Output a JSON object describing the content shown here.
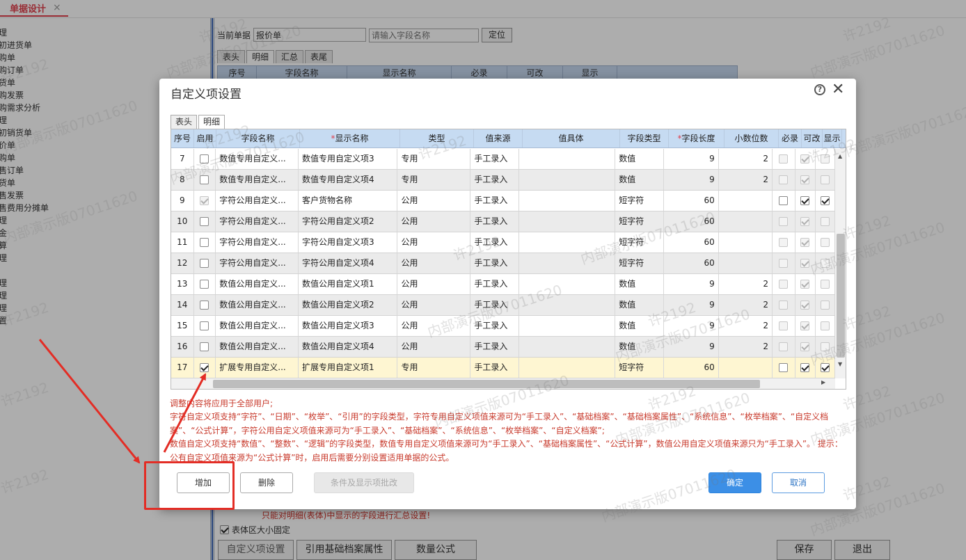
{
  "app": {
    "tab_title": "单据设计",
    "tab_close": "×",
    "nav_items": [
      "理",
      "初进货单",
      "购单",
      "购订单",
      "货单",
      "购发票",
      "购需求分析",
      "理",
      "初销货单",
      "价单",
      "购单",
      "售订单",
      "货单",
      "售发票",
      "售费用分摊单",
      "理",
      "金",
      "算",
      "理",
      "理",
      "理",
      "理",
      "置"
    ],
    "current_doc_label": "当前单据",
    "current_doc_value": "报价单",
    "field_search_placeholder": "请输入字段名称",
    "locate_button": "定位",
    "tabs": [
      "表头",
      "明细",
      "汇总",
      "表尾"
    ],
    "table_headers": [
      "序号",
      "字段名称",
      "显示名称",
      "必录",
      "可改",
      "显示"
    ],
    "summary_warning": "只能对明细(表体)中显示的字段进行汇总设置!",
    "fixed_size_label": "表体区大小固定",
    "bottom_buttons": [
      "自定义项设置",
      "引用基础档案属性",
      "数量公式"
    ],
    "save_button": "保存",
    "exit_button": "退出"
  },
  "watermark": {
    "user": "许2192",
    "version": "内部演示版07011620"
  },
  "dialog": {
    "title": "自定义项设置",
    "help_icon": "question-circle-icon",
    "close_icon": "close-icon",
    "tabs": [
      "表头",
      "明细"
    ],
    "active_tab": "明细",
    "columns": [
      {
        "label": "序号",
        "required": false
      },
      {
        "label": "启用",
        "required": false
      },
      {
        "label": "字段名称",
        "required": false
      },
      {
        "label": "显示名称",
        "required": true
      },
      {
        "label": "类型",
        "required": false
      },
      {
        "label": "值来源",
        "required": false
      },
      {
        "label": "值具体",
        "required": false
      },
      {
        "label": "字段类型",
        "required": false
      },
      {
        "label": "字段长度",
        "required": true
      },
      {
        "label": "小数位数",
        "required": false
      },
      {
        "label": "必录",
        "required": false
      },
      {
        "label": "可改",
        "required": false
      },
      {
        "label": "显示",
        "required": false
      }
    ],
    "rows": [
      {
        "no": "7",
        "enabled": false,
        "field": "数值专用自定义...",
        "display": "数值专用自定义项3",
        "type": "专用",
        "source": "手工录入",
        "detail": "",
        "ftype": "数值",
        "length": "9",
        "decimals": "2",
        "required": false,
        "editable": true,
        "visible": false,
        "active": false
      },
      {
        "no": "8",
        "enabled": false,
        "field": "数值专用自定义...",
        "display": "数值专用自定义项4",
        "type": "专用",
        "source": "手工录入",
        "detail": "",
        "ftype": "数值",
        "length": "9",
        "decimals": "2",
        "required": false,
        "editable": true,
        "visible": false,
        "active": false
      },
      {
        "no": "9",
        "enabled": true,
        "field": "字符公用自定义...",
        "display": "客户货物名称",
        "type": "公用",
        "source": "手工录入",
        "detail": "",
        "ftype": "短字符",
        "length": "60",
        "decimals": "",
        "required": false,
        "editable": true,
        "visible": true,
        "active": true
      },
      {
        "no": "10",
        "enabled": false,
        "field": "字符公用自定义...",
        "display": "字符公用自定义项2",
        "type": "公用",
        "source": "手工录入",
        "detail": "",
        "ftype": "短字符",
        "length": "60",
        "decimals": "",
        "required": false,
        "editable": true,
        "visible": false,
        "active": false
      },
      {
        "no": "11",
        "enabled": false,
        "field": "字符公用自定义...",
        "display": "字符公用自定义项3",
        "type": "公用",
        "source": "手工录入",
        "detail": "",
        "ftype": "短字符",
        "length": "60",
        "decimals": "",
        "required": false,
        "editable": true,
        "visible": false,
        "active": false
      },
      {
        "no": "12",
        "enabled": false,
        "field": "字符公用自定义...",
        "display": "字符公用自定义项4",
        "type": "公用",
        "source": "手工录入",
        "detail": "",
        "ftype": "短字符",
        "length": "60",
        "decimals": "",
        "required": false,
        "editable": true,
        "visible": false,
        "active": false
      },
      {
        "no": "13",
        "enabled": false,
        "field": "数值公用自定义...",
        "display": "数值公用自定义项1",
        "type": "公用",
        "source": "手工录入",
        "detail": "",
        "ftype": "数值",
        "length": "9",
        "decimals": "2",
        "required": false,
        "editable": true,
        "visible": false,
        "active": false
      },
      {
        "no": "14",
        "enabled": false,
        "field": "数值公用自定义...",
        "display": "数值公用自定义项2",
        "type": "公用",
        "source": "手工录入",
        "detail": "",
        "ftype": "数值",
        "length": "9",
        "decimals": "2",
        "required": false,
        "editable": true,
        "visible": false,
        "active": false
      },
      {
        "no": "15",
        "enabled": false,
        "field": "数值公用自定义...",
        "display": "数值公用自定义项3",
        "type": "公用",
        "source": "手工录入",
        "detail": "",
        "ftype": "数值",
        "length": "9",
        "decimals": "2",
        "required": false,
        "editable": true,
        "visible": false,
        "active": false
      },
      {
        "no": "16",
        "enabled": false,
        "field": "数值公用自定义...",
        "display": "数值公用自定义项4",
        "type": "公用",
        "source": "手工录入",
        "detail": "",
        "ftype": "数值",
        "length": "9",
        "decimals": "2",
        "required": false,
        "editable": true,
        "visible": false,
        "active": false
      },
      {
        "no": "17",
        "enabled": true,
        "field": "扩展专用自定义...",
        "display": "扩展专用自定义项1",
        "type": "专用",
        "source": "手工录入",
        "detail": "",
        "ftype": "短字符",
        "length": "60",
        "decimals": "",
        "required": false,
        "editable": true,
        "visible": true,
        "active": true,
        "selected": true
      }
    ],
    "notes": [
      "调整内容将应用于全部用户;",
      "字符自定义项支持“字符”、“日期”、“枚举”、“引用”的字段类型，字符专用自定义项值来源可为“手工录入”、“基础档案”、“基础档案属性”、“系统信息”、“枚举档案”、“自定义档案”、“公式计算”，字符公用自定义项值来源可为“手工录入”、“基础档案”、“系统信息”、“枚举档案”、“自定义档案”;",
      "数值自定义项支持“数值”、“整数”、“逻辑”的字段类型，数值专用自定义项值来源可为“手工录入”、“基础档案属性”、“公式计算”，数值公用自定义项值来源只为“手工录入”。 提示：公有自定义项值来源为“公式计算”时，启用后需要分别设置适用单据的公式。"
    ],
    "buttons": {
      "add": "增加",
      "delete": "删除",
      "batch": "条件及显示项批改",
      "ok": "确定",
      "cancel": "取消"
    }
  },
  "colors": {
    "accent": "#e0414d",
    "primary": "#3c8fe6",
    "header_bg": "#c6dbf2",
    "note_text": "#c83a2c",
    "annotation_red": "#e32d25"
  }
}
